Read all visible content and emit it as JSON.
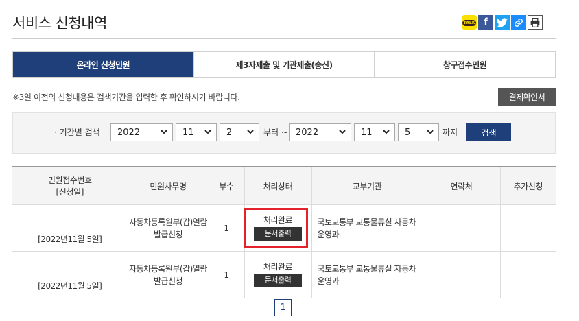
{
  "page": {
    "title": "서비스 신청내역"
  },
  "share": {
    "kakao_label": "TALK",
    "facebook_label": "f",
    "colors": {
      "kakao": "#f9e000",
      "facebook": "#3b5998",
      "twitter": "#1da1f2",
      "link": "#1a8cff"
    }
  },
  "tabs": [
    {
      "label": "온라인 신청민원",
      "active": true
    },
    {
      "label": "제3자제출 및 기관제출(송신)",
      "active": false
    },
    {
      "label": "창구접수민원",
      "active": false
    }
  ],
  "notice": "※3일 이전의 신청내용은 검색기간을 입력한 후 확인하시기 바랍니다.",
  "receipt_button": "결제확인서",
  "search": {
    "label": "· 기간별 검색",
    "from_year": "2022",
    "from_month": "11",
    "from_day": "2",
    "from_text": "부터 ~",
    "to_year": "2022",
    "to_month": "11",
    "to_day": "5",
    "to_text": "까지",
    "button": "검색"
  },
  "table": {
    "headers": {
      "receipt_no_line1": "민원접수번호",
      "receipt_no_line2": "[신청일]",
      "affair": "민원사무명",
      "copies": "부수",
      "status": "처리상태",
      "issuer": "교부기관",
      "contact": "연락처",
      "extra": "추가신청"
    },
    "rows": [
      {
        "date": "[2022년11월 5일]",
        "affair_line1": "자동차등록원부(갑)열람",
        "affair_line2": "발급신청",
        "copies": "1",
        "status": "처리완료",
        "print_button": "문서출력",
        "issuer_line1": "국토교통부 교통물류실 자동차",
        "issuer_line2": "운영과",
        "contact": "",
        "extra": ""
      },
      {
        "date": "[2022년11월 5일]",
        "affair_line1": "자동차등록원부(갑)열람",
        "affair_line2": "발급신청",
        "copies": "1",
        "status": "처리완료",
        "print_button": "문서출력",
        "issuer_line1": "국토교통부 교통물류실 자동차",
        "issuer_line2": "운영과",
        "contact": "",
        "extra": ""
      }
    ]
  },
  "pagination": {
    "current": "1"
  },
  "accent_colors": {
    "primary": "#1e3f7a",
    "highlight": "#e3222c"
  }
}
